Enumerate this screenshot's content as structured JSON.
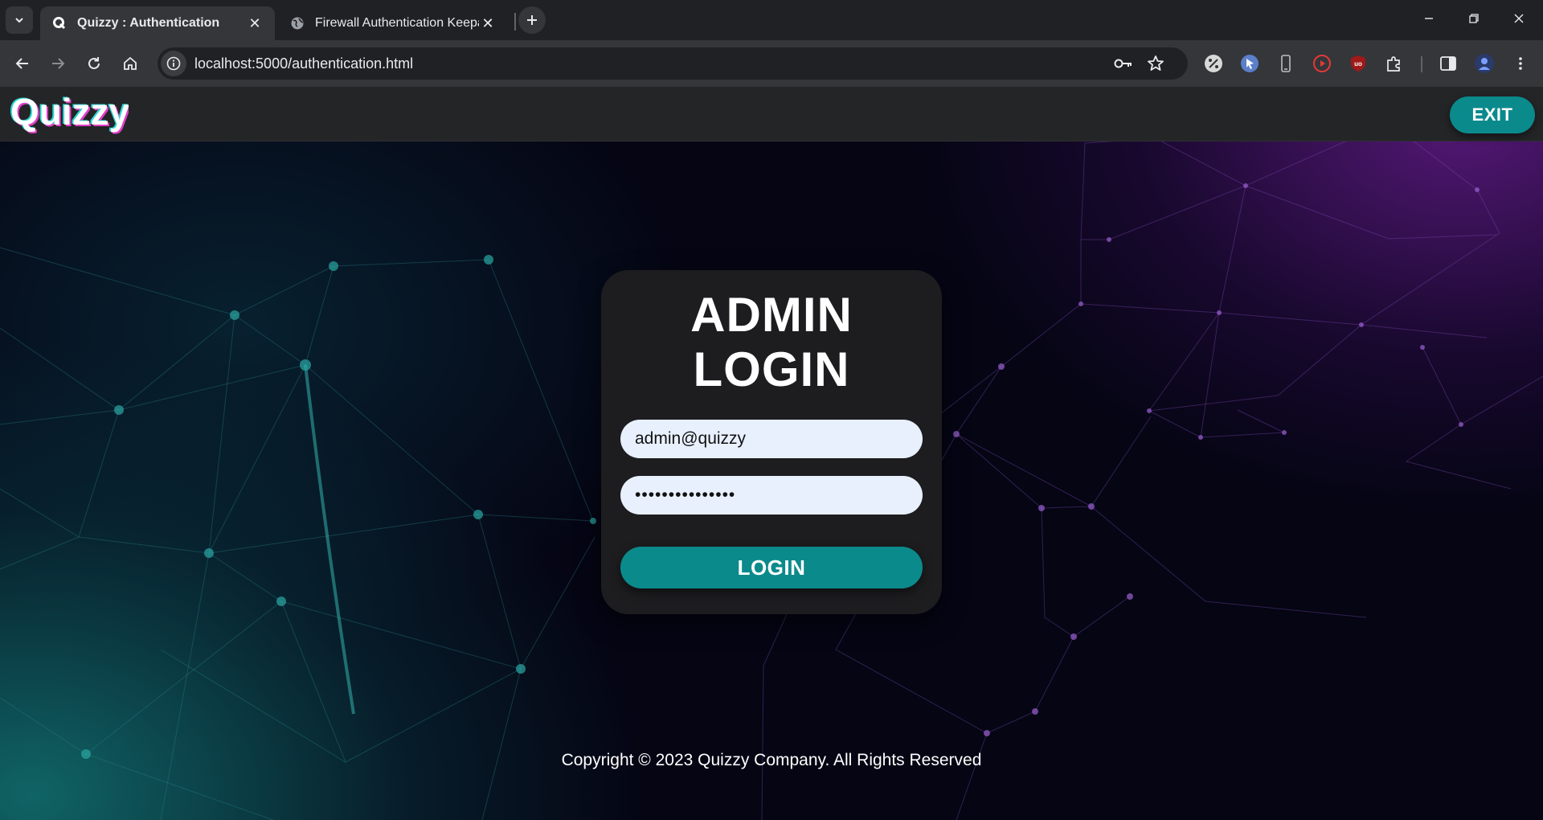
{
  "browser": {
    "tabs": [
      {
        "title": "Quizzy : Authentication",
        "favicon": "quizzy-q-icon",
        "active": true
      },
      {
        "title": "Firewall Authentication Keepal",
        "favicon": "globe-icon",
        "active": false
      }
    ],
    "url": "localhost:5000/authentication.html",
    "extensions": [
      "percent-icon",
      "cursor-icon",
      "phone-icon",
      "play-icon",
      "ublock-icon",
      "puzzle-icon"
    ]
  },
  "header": {
    "logo_text": "Quizzy",
    "exit_label": "EXIT"
  },
  "login": {
    "title_line1": "ADMIN",
    "title_line2": "LOGIN",
    "email_value": "admin@quizzy",
    "password_value": "•••••••••••••••",
    "submit_label": "LOGIN"
  },
  "footer": {
    "copyright": "Copyright © 2023 Quizzy Company. All Rights Reserved"
  },
  "colors": {
    "accent": "#0b8a8c",
    "card": "#1d1d20",
    "header": "#242527",
    "input": "#e8f0fe"
  }
}
